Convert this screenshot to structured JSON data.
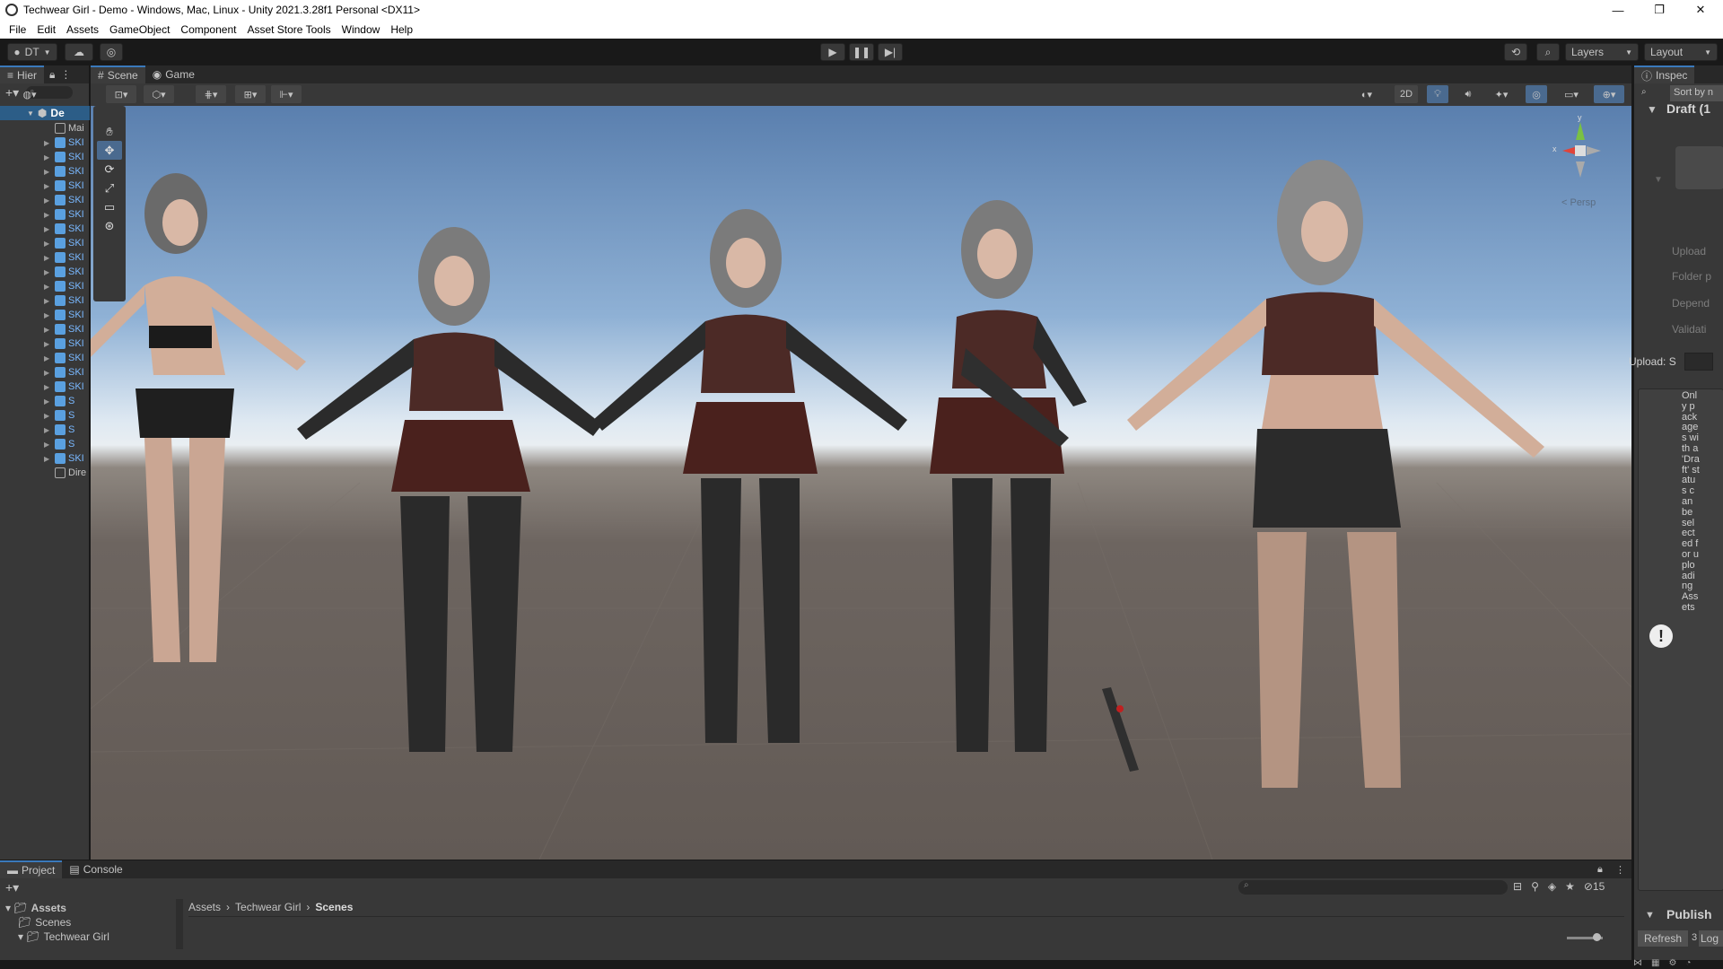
{
  "window": {
    "title": "Techwear Girl - Demo - Windows, Mac, Linux - Unity 2021.3.28f1 Personal <DX11>",
    "controls": [
      "—",
      "❐",
      "✕"
    ]
  },
  "menu": [
    "File",
    "Edit",
    "Assets",
    "GameObject",
    "Component",
    "Asset Store Tools",
    "Window",
    "Help"
  ],
  "toolbar": {
    "account": "DT",
    "layers": "Layers",
    "layout": "Layout"
  },
  "hierarchy": {
    "tab": "Hier",
    "root": "De",
    "items": [
      {
        "name": "Mai",
        "type": "camera"
      },
      {
        "name": "SKI",
        "type": "prefab"
      },
      {
        "name": "SKI",
        "type": "prefab"
      },
      {
        "name": "SKI",
        "type": "prefab"
      },
      {
        "name": "SKI",
        "type": "prefab"
      },
      {
        "name": "SKI",
        "type": "prefab"
      },
      {
        "name": "SKI",
        "type": "prefab"
      },
      {
        "name": "SKI",
        "type": "prefab"
      },
      {
        "name": "SKI",
        "type": "prefab"
      },
      {
        "name": "SKI",
        "type": "prefab"
      },
      {
        "name": "SKI",
        "type": "prefab"
      },
      {
        "name": "SKI",
        "type": "prefab"
      },
      {
        "name": "SKI",
        "type": "prefab"
      },
      {
        "name": "SKI",
        "type": "prefab"
      },
      {
        "name": "SKI",
        "type": "prefab"
      },
      {
        "name": "SKI",
        "type": "prefab"
      },
      {
        "name": "SKI",
        "type": "prefab"
      },
      {
        "name": "SKI",
        "type": "prefab"
      },
      {
        "name": "SKI",
        "type": "prefab"
      },
      {
        "name": "S",
        "type": "prefab"
      },
      {
        "name": "S",
        "type": "prefab"
      },
      {
        "name": "S",
        "type": "prefab"
      },
      {
        "name": "S",
        "type": "prefab"
      },
      {
        "name": "SKI",
        "type": "prefab"
      },
      {
        "name": "Dire",
        "type": "light"
      }
    ]
  },
  "scene": {
    "tabs": [
      "Scene",
      "Game"
    ],
    "btn_2d": "2D",
    "persp": "< Persp",
    "gizmo": {
      "y": "y",
      "x": "x"
    }
  },
  "inspector": {
    "tab": "Inspec",
    "sort": "Sort by n",
    "header": "Draft (1",
    "fields": [
      "Upload",
      "Folder p",
      "Depend",
      "Validati"
    ],
    "upload_label": "Upload: S",
    "message": "Only packages with a 'Draft' status can be selected for uploading Assets",
    "publish": "Publish",
    "refresh": "Refresh",
    "refresh_count": "3",
    "log": "Log"
  },
  "project": {
    "tabs": [
      "Project",
      "Console"
    ],
    "tree": [
      {
        "label": "Assets",
        "depth": 0,
        "bold": true
      },
      {
        "label": "Scenes",
        "depth": 1,
        "bold": false
      },
      {
        "label": "Techwear Girl",
        "depth": 1,
        "bold": false
      }
    ],
    "breadcrumb": [
      "Assets",
      "Techwear Girl",
      "Scenes"
    ],
    "hidden_count": "15"
  }
}
